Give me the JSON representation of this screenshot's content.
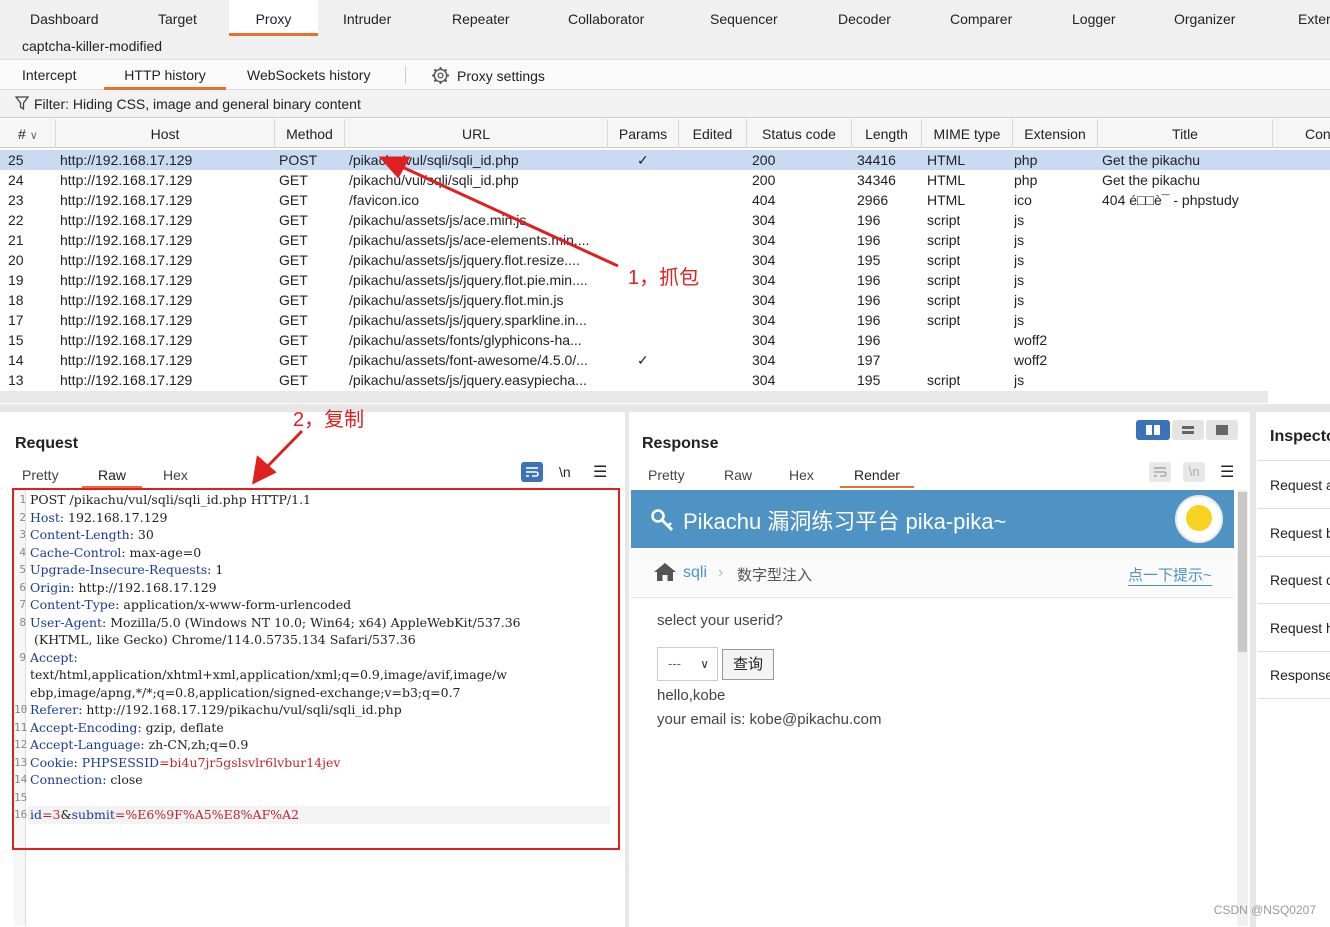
{
  "top_tabs": [
    "Dashboard",
    "Target",
    "Proxy",
    "Intruder",
    "Repeater",
    "Collaborator",
    "Sequencer",
    "Decoder",
    "Comparer",
    "Logger",
    "Organizer",
    "Exter"
  ],
  "project_name": "captcha-killer-modified",
  "sub_tabs": [
    "Intercept",
    "HTTP history",
    "WebSockets history"
  ],
  "proxy_settings_label": "Proxy settings",
  "filter_text": "Filter: Hiding CSS, image and general binary content",
  "columns": [
    "#",
    "Host",
    "Method",
    "URL",
    "Params",
    "Edited",
    "Status code",
    "Length",
    "MIME type",
    "Extension",
    "Title",
    "Con"
  ],
  "rows": [
    {
      "num": "25",
      "host": "http://192.168.17.129",
      "method": "POST",
      "url": "/pikachu/vul/sqli/sqli_id.php",
      "params": "✓",
      "status": "200",
      "length": "34416",
      "mime": "HTML",
      "ext": "php",
      "title": "Get the pikachu"
    },
    {
      "num": "24",
      "host": "http://192.168.17.129",
      "method": "GET",
      "url": "/pikachu/vul/sqli/sqli_id.php",
      "params": "",
      "status": "200",
      "length": "34346",
      "mime": "HTML",
      "ext": "php",
      "title": "Get the pikachu"
    },
    {
      "num": "23",
      "host": "http://192.168.17.129",
      "method": "GET",
      "url": "/favicon.ico",
      "params": "",
      "status": "404",
      "length": "2966",
      "mime": "HTML",
      "ext": "ico",
      "title": "404 é□□è¯ - phpstudy"
    },
    {
      "num": "22",
      "host": "http://192.168.17.129",
      "method": "GET",
      "url": "/pikachu/assets/js/ace.min.js",
      "params": "",
      "status": "304",
      "length": "196",
      "mime": "script",
      "ext": "js",
      "title": ""
    },
    {
      "num": "21",
      "host": "http://192.168.17.129",
      "method": "GET",
      "url": "/pikachu/assets/js/ace-elements.min....",
      "params": "",
      "status": "304",
      "length": "196",
      "mime": "script",
      "ext": "js",
      "title": ""
    },
    {
      "num": "20",
      "host": "http://192.168.17.129",
      "method": "GET",
      "url": "/pikachu/assets/js/jquery.flot.resize....",
      "params": "",
      "status": "304",
      "length": "195",
      "mime": "script",
      "ext": "js",
      "title": ""
    },
    {
      "num": "19",
      "host": "http://192.168.17.129",
      "method": "GET",
      "url": "/pikachu/assets/js/jquery.flot.pie.min....",
      "params": "",
      "status": "304",
      "length": "196",
      "mime": "script",
      "ext": "js",
      "title": ""
    },
    {
      "num": "18",
      "host": "http://192.168.17.129",
      "method": "GET",
      "url": "/pikachu/assets/js/jquery.flot.min.js",
      "params": "",
      "status": "304",
      "length": "196",
      "mime": "script",
      "ext": "js",
      "title": ""
    },
    {
      "num": "17",
      "host": "http://192.168.17.129",
      "method": "GET",
      "url": "/pikachu/assets/js/jquery.sparkline.in...",
      "params": "",
      "status": "304",
      "length": "196",
      "mime": "script",
      "ext": "js",
      "title": ""
    },
    {
      "num": "15",
      "host": "http://192.168.17.129",
      "method": "GET",
      "url": "/pikachu/assets/fonts/glyphicons-ha...",
      "params": "",
      "status": "304",
      "length": "196",
      "mime": "",
      "ext": "woff2",
      "title": ""
    },
    {
      "num": "14",
      "host": "http://192.168.17.129",
      "method": "GET",
      "url": "/pikachu/assets/font-awesome/4.5.0/...",
      "params": "✓",
      "status": "304",
      "length": "197",
      "mime": "",
      "ext": "woff2",
      "title": ""
    },
    {
      "num": "13",
      "host": "http://192.168.17.129",
      "method": "GET",
      "url": "/pikachu/assets/js/jquery.easypiecha...",
      "params": "",
      "status": "304",
      "length": "195",
      "mime": "script",
      "ext": "js",
      "title": ""
    }
  ],
  "request": {
    "title": "Request",
    "tabs": [
      "Pretty",
      "Raw",
      "Hex"
    ],
    "lines": [
      {
        "n": "1",
        "k": "",
        "v": "POST /pikachu/vul/sqli/sqli_id.php HTTP/1.1"
      },
      {
        "n": "2",
        "k": "Host",
        "v": ": 192.168.17.129"
      },
      {
        "n": "3",
        "k": "Content-Length",
        "v": ": 30"
      },
      {
        "n": "4",
        "k": "Cache-Control",
        "v": ": max-age=0"
      },
      {
        "n": "5",
        "k": "Upgrade-Insecure-Requests",
        "v": ": 1"
      },
      {
        "n": "6",
        "k": "Origin",
        "v": ": http://192.168.17.129"
      },
      {
        "n": "7",
        "k": "Content-Type",
        "v": ": application/x-www-form-urlencoded"
      },
      {
        "n": "8",
        "k": "User-Agent",
        "v": ": Mozilla/5.0 (Windows NT 10.0; Win64; x64) AppleWebKit/537.36"
      },
      {
        "n": "",
        "k": "",
        "v": " (KHTML, like Gecko) Chrome/114.0.5735.134 Safari/537.36"
      },
      {
        "n": "9",
        "k": "Accept",
        "v": ":"
      },
      {
        "n": "",
        "k": "",
        "v": "text/html,application/xhtml+xml,application/xml;q=0.9,image/avif,image/w"
      },
      {
        "n": "",
        "k": "",
        "v": "ebp,image/apng,*/*;q=0.8,application/signed-exchange;v=b3;q=0.7"
      },
      {
        "n": "10",
        "k": "Referer",
        "v": ": http://192.168.17.129/pikachu/vul/sqli/sqli_id.php"
      },
      {
        "n": "11",
        "k": "Accept-Encoding",
        "v": ": gzip, deflate"
      },
      {
        "n": "12",
        "k": "Accept-Language",
        "v": ": zh-CN,zh;q=0.9"
      },
      {
        "n": "13",
        "k": "Cookie",
        "v": ": "
      },
      {
        "n": "14",
        "k": "Connection",
        "v": ": close"
      },
      {
        "n": "15",
        "k": "",
        "v": ""
      },
      {
        "n": "16",
        "k": "",
        "v": ""
      }
    ],
    "cookie_name": "PHPSESSID",
    "cookie_value": "=bi4u7jr5gslsvlr6lvbur14jev",
    "body_key1": "id",
    "body_val1": "=3",
    "body_amp": "&",
    "body_key2": "submit",
    "body_val2": "=%E6%9F%A5%E8%AF%A2"
  },
  "response": {
    "title": "Response",
    "tabs": [
      "Pretty",
      "Raw",
      "Hex",
      "Render"
    ],
    "render_title": "Pikachu 漏洞练习平台 pika-pika~",
    "breadcrumb_1": "sqli",
    "breadcrumb_2": "数字型注入",
    "hint_link": "点一下提示~",
    "question": "select your userid?",
    "select_value": "---",
    "query_button": "查询",
    "result_1": "hello,kobe",
    "result_2": "your email is: kobe@pikachu.com"
  },
  "inspector": {
    "title": "Inspecto",
    "items": [
      "Request a",
      "Request b",
      "Request c",
      "Request h",
      "Response"
    ]
  },
  "annotations": {
    "capture": "1，抓包",
    "copy": "2，复制"
  },
  "watermark": "CSDN @NSQ0207",
  "colors": {
    "accent": "#e8702a",
    "selected_row": "#c9daf2",
    "annotation": "#e02020",
    "render_banner": "#4e93c3"
  }
}
